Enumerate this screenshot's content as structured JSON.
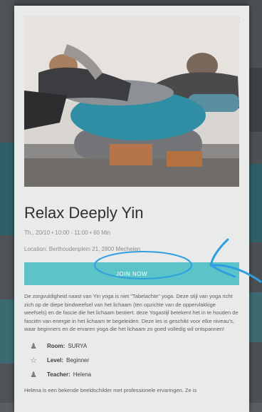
{
  "modal": {
    "close_icon": "close-icon",
    "title": "Relax Deeply Yin",
    "meta": "Th., 20/10 • 10:00 - 11:00 • 60 Min",
    "location": "Location: Berthoudenplein 21, 2800 Mechelen",
    "join_label": "JOIN NOW",
    "description": "De zorgvuldigheid naast van Yin yoga is niet \"Tabelachte\" yoga. Deze stijl van yoga richt zich op de diepe bindweefsel van het lichaam (ten opzichte van de oppervlakkige weefsels) en de fascie die het lichaam bestiert. deze Yogastijl betekent het in te houden de fasciën van energie in het lichaam te begeleiden. Deze les is geschikt voor elke niveau's, waar beginners en de ervaren yoga die het lichaam zo goed volledig wil ontspannen!",
    "info": {
      "room_label": "Room:",
      "room_value": "SURYA",
      "level_label": "Level:",
      "level_value": "Beginner",
      "teacher_label": "Teacher:",
      "teacher_value": "Helena"
    },
    "bio": "Helena is een bekende beeldschilder met professionele ervaringen. Ze is"
  },
  "colors": {
    "accent": "#5cc3c8",
    "annotation": "#2f9fe0"
  },
  "icons": {
    "room": "person-icon",
    "level": "star-icon",
    "teacher": "person-icon"
  }
}
